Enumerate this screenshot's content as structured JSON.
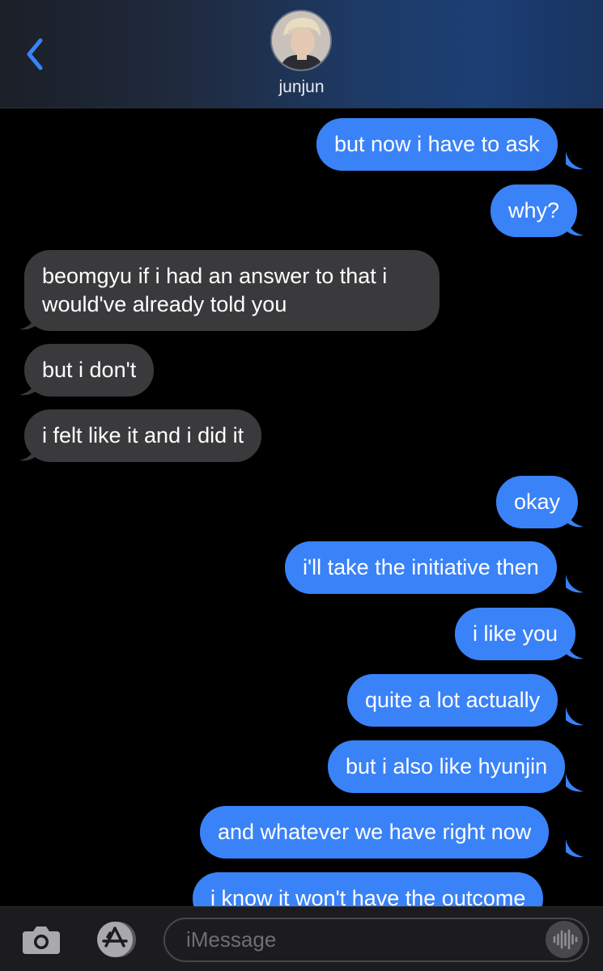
{
  "header": {
    "contact_name": "junjun"
  },
  "messages": [
    {
      "from": "me",
      "text": "but now i have to ask"
    },
    {
      "from": "me",
      "text": "why?"
    },
    {
      "from": "them",
      "text": "beomgyu if i had an answer to that i would've already told you"
    },
    {
      "from": "them",
      "text": "but i don't"
    },
    {
      "from": "them",
      "text": "i felt like it and i did it"
    },
    {
      "from": "me",
      "text": "okay"
    },
    {
      "from": "me",
      "text": "i'll take the initiative then"
    },
    {
      "from": "me",
      "text": "i like you"
    },
    {
      "from": "me",
      "text": "quite a lot actually"
    },
    {
      "from": "me",
      "text": "but i also like hyunjin"
    },
    {
      "from": "me",
      "text": "and whatever we have right now"
    },
    {
      "from": "me",
      "text": "i know it won't have the outcome"
    }
  ],
  "composer": {
    "placeholder": "iMessage"
  },
  "colors": {
    "sent_bubble": "#3a82f7",
    "received_bubble": "#3a3a3c",
    "accent": "#3a82f7"
  },
  "icons": [
    "back-chevron-icon",
    "camera-icon",
    "app-store-icon",
    "audio-waveform-icon"
  ]
}
